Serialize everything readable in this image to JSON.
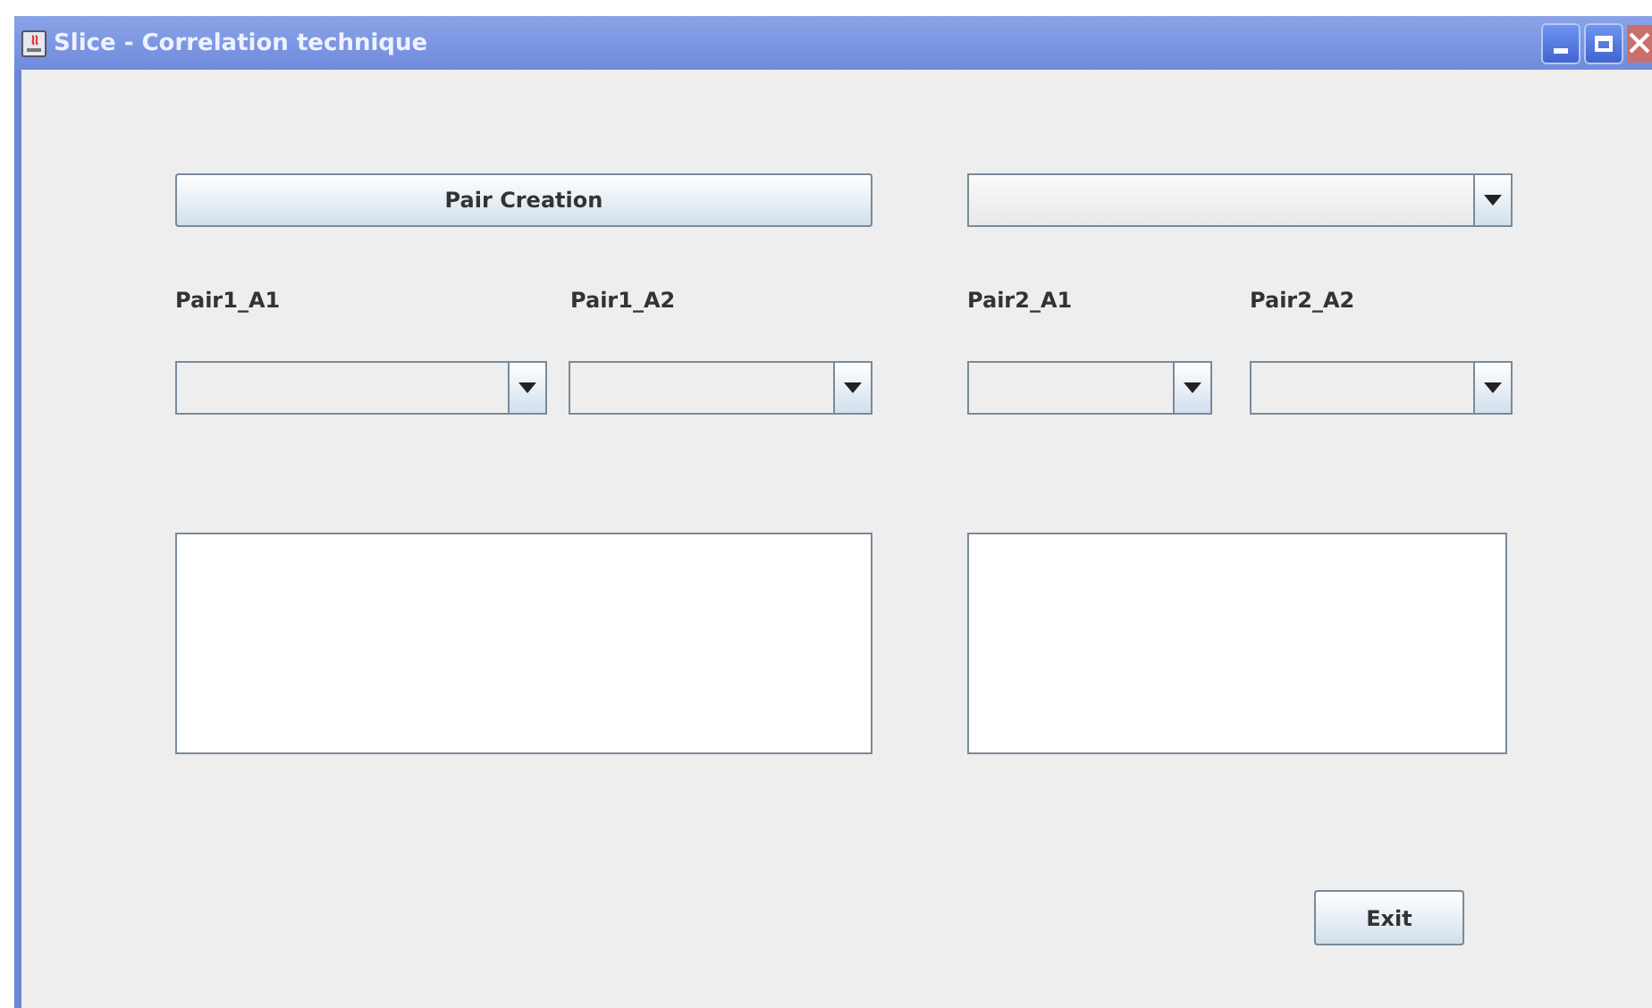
{
  "window": {
    "title": "Slice - Correlation technique"
  },
  "pair_button": {
    "label": "Pair Creation"
  },
  "pairs": [
    {
      "label": "Pair1_A1"
    },
    {
      "label": "Pair1_A2"
    },
    {
      "label": "Pair2_A1"
    },
    {
      "label": "Pair2_A2"
    }
  ],
  "exit_button": {
    "label": "Exit"
  }
}
